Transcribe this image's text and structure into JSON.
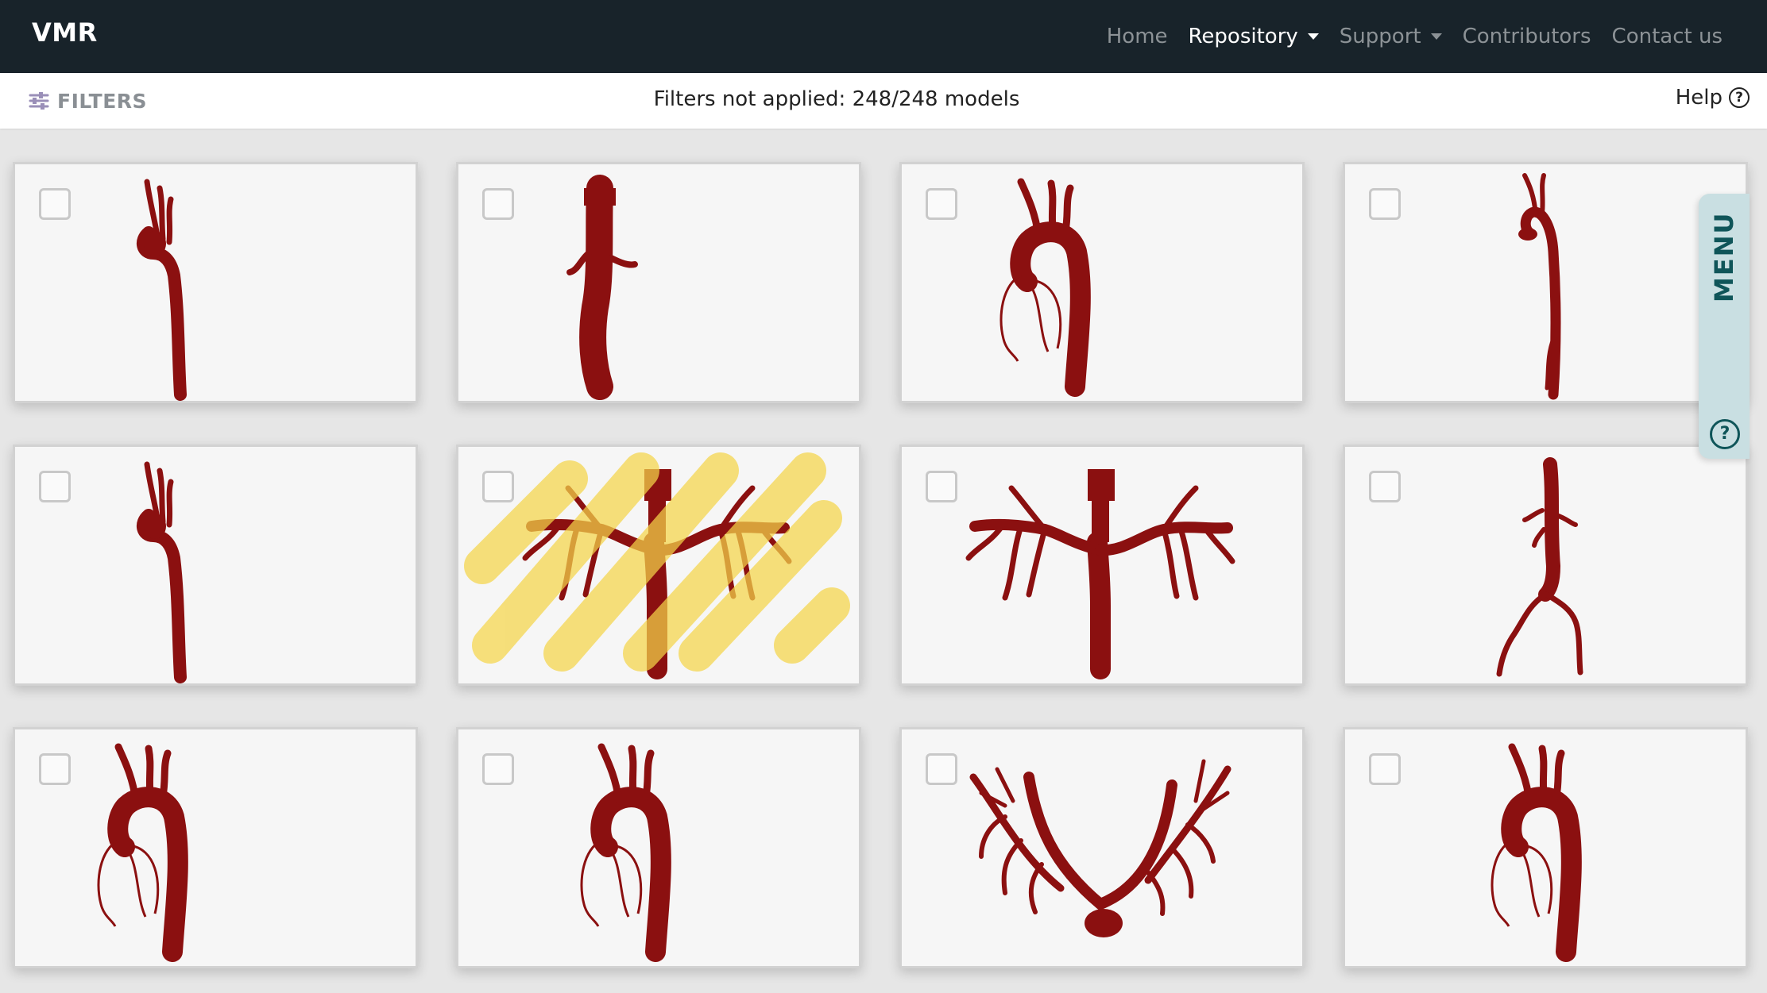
{
  "navbar": {
    "brand": "VMR",
    "links": [
      {
        "label": "Home",
        "active": false,
        "dropdown": false
      },
      {
        "label": "Repository",
        "active": true,
        "dropdown": true
      },
      {
        "label": "Support",
        "active": false,
        "dropdown": true
      },
      {
        "label": "Contributors",
        "active": false,
        "dropdown": false
      },
      {
        "label": "Contact us",
        "active": false,
        "dropdown": false
      }
    ]
  },
  "filterbar": {
    "filters_label": "FILTERS",
    "filters_icon": "sliders-icon",
    "status": "Filters not applied: 248/248 models",
    "help_label": "Help",
    "help_icon": "question-circle-icon"
  },
  "side_menu": {
    "label": "MENU",
    "help_icon": "question-circle-icon"
  },
  "models": [
    {
      "checked": false,
      "shape": "aorta-with-arch-branches"
    },
    {
      "checked": false,
      "shape": "abdominal-aorta-segment"
    },
    {
      "checked": false,
      "shape": "aortic-arch-with-coronaries"
    },
    {
      "checked": false,
      "shape": "thin-aorta"
    },
    {
      "checked": false,
      "shape": "aorta-with-arch-branches"
    },
    {
      "checked": false,
      "shape": "pulmonary-tree",
      "highlighted": true
    },
    {
      "checked": false,
      "shape": "pulmonary-tree"
    },
    {
      "checked": false,
      "shape": "aorta-iliac-bifurcation"
    },
    {
      "checked": false,
      "shape": "aortic-arch-with-coronaries"
    },
    {
      "checked": false,
      "shape": "aortic-arch-with-coronaries"
    },
    {
      "checked": false,
      "shape": "pulmonary-tree-wide"
    },
    {
      "checked": false,
      "shape": "aortic-arch-with-coronaries"
    }
  ],
  "colors": {
    "navbar_bg": "#18232a",
    "vessel": "#8b1010",
    "highlight": "#f5d54a",
    "menu_bg": "#c9dfe2",
    "menu_text": "#0f5559"
  }
}
